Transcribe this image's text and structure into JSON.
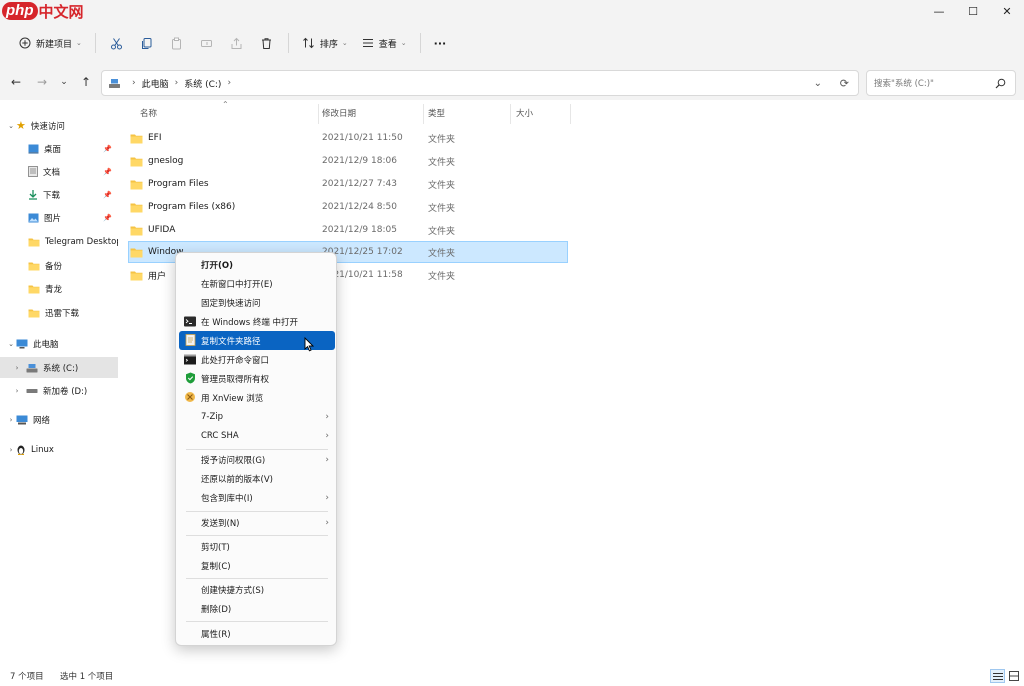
{
  "watermark": {
    "part_a": "php",
    "part_b": "中文网"
  },
  "window_controls": {
    "minimize": "—",
    "maximize": "☐",
    "close": "✕"
  },
  "toolbar": {
    "new_label": "新建项目",
    "sort_label": "排序",
    "view_label": "查看",
    "more_label": "···",
    "icons": [
      "cut-icon",
      "copy-icon",
      "paste-icon",
      "rename-icon",
      "share-icon",
      "delete-icon"
    ]
  },
  "nav": {
    "back": "←",
    "forward": "→",
    "recent": "⌄",
    "up": "↑",
    "refresh": "⟳",
    "dropdown": "⌄"
  },
  "address": {
    "crumbs": [
      "此电脑",
      "系统 (C:)"
    ]
  },
  "search": {
    "placeholder": "搜索\"系统 (C:)\""
  },
  "sidebar": {
    "quick_access": "快速访问",
    "items": [
      {
        "label": "桌面",
        "pinned": true
      },
      {
        "label": "文档",
        "pinned": true
      },
      {
        "label": "下载",
        "pinned": true
      },
      {
        "label": "图片",
        "pinned": true
      },
      {
        "label": "Telegram Desktop",
        "pinned": false
      },
      {
        "label": "备份",
        "pinned": false
      },
      {
        "label": "青龙",
        "pinned": false
      },
      {
        "label": "迅雷下载",
        "pinned": false
      }
    ],
    "this_pc": "此电脑",
    "drives": [
      "系统 (C:)",
      "新加卷 (D:)"
    ],
    "network": "网络",
    "linux": "Linux"
  },
  "columns": {
    "name": "名称",
    "date": "修改日期",
    "type": "类型",
    "size": "大小"
  },
  "files": [
    {
      "name": "EFI",
      "date": "2021/10/21 11:50",
      "type": "文件夹"
    },
    {
      "name": "gneslog",
      "date": "2021/12/9 18:06",
      "type": "文件夹"
    },
    {
      "name": "Program Files",
      "date": "2021/12/27 7:43",
      "type": "文件夹"
    },
    {
      "name": "Program Files (x86)",
      "date": "2021/12/24 8:50",
      "type": "文件夹"
    },
    {
      "name": "UFIDA",
      "date": "2021/12/9 18:05",
      "type": "文件夹"
    },
    {
      "name": "Window",
      "date": "2021/12/25 17:02",
      "type": "文件夹",
      "selected": true
    },
    {
      "name": "用户",
      "date": "2021/10/21 11:58",
      "type": "文件夹"
    }
  ],
  "context_menu": {
    "items": [
      {
        "label": "打开(O)",
        "bold": true
      },
      {
        "label": "在新窗口中打开(E)"
      },
      {
        "label": "固定到快速访问"
      },
      {
        "label": "在 Windows 终端 中打开",
        "icon": "terminal-icon"
      },
      {
        "label": "复制文件夹路径",
        "icon": "copy-path-icon",
        "highlighted": true
      },
      {
        "label": "此处打开命令窗口",
        "icon": "cmd-icon"
      },
      {
        "label": "管理员取得所有权",
        "icon": "shield-icon"
      },
      {
        "label": "用 XnView 浏览",
        "icon": "xnview-icon"
      },
      {
        "label": "7-Zip",
        "submenu": true
      },
      {
        "label": "CRC SHA",
        "submenu": true
      },
      {
        "label": "授予访问权限(G)",
        "submenu": true
      },
      {
        "label": "还原以前的版本(V)"
      },
      {
        "label": "包含到库中(I)",
        "submenu": true
      },
      {
        "label": "发送到(N)",
        "submenu": true
      },
      {
        "label": "剪切(T)"
      },
      {
        "label": "复制(C)"
      },
      {
        "label": "创建快捷方式(S)"
      },
      {
        "label": "删除(D)"
      },
      {
        "label": "属性(R)"
      }
    ],
    "submenu_arrow": "›"
  },
  "status": {
    "count": "7 个项目",
    "selected": "选中 1 个项目"
  },
  "colors": {
    "accent": "#0a64c2",
    "selection": "#cce8ff",
    "folder": "#f5c344"
  }
}
